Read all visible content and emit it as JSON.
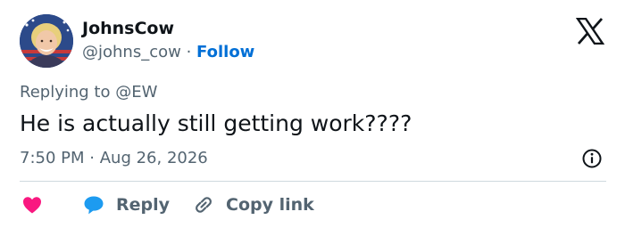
{
  "author": {
    "name": "JohnsCow",
    "handle": "@johns_cow",
    "separator": "·",
    "follow_label": "Follow"
  },
  "tweet": {
    "replying_prefix": "Replying to",
    "replying_to": "@EW",
    "text": "He is actually still getting work????",
    "time": "7:50 PM",
    "meta_separator": "·",
    "date": "Aug 26, 2026"
  },
  "actions": {
    "reply_label": "Reply",
    "copy_link_label": "Copy link"
  },
  "icons": {
    "logo": "x-logo-icon",
    "info": "info-icon",
    "like": "heart-icon",
    "reply": "speech-bubble-icon",
    "copy_link": "link-icon"
  },
  "colors": {
    "follow": "#006fd6",
    "heart": "#f91880",
    "reply_bubble": "#1d9bf0",
    "secondary_text": "#536471"
  }
}
